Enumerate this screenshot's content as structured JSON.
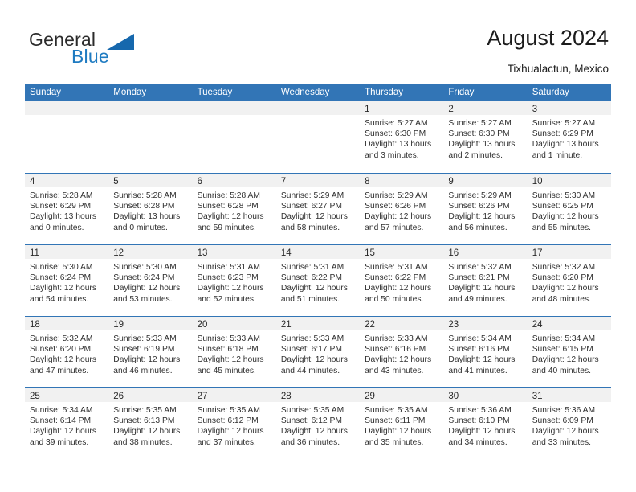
{
  "brand": {
    "word_one": "General",
    "word_two": "Blue",
    "triangle_icon": "triangle-logo-icon",
    "accent_color": "#1f7bc1"
  },
  "header": {
    "title": "August 2024",
    "location": "Tixhualactun, Mexico",
    "header_bg_color": "#3275b6",
    "daynum_band_color": "#f1f1f1"
  },
  "weekdays": [
    "Sunday",
    "Monday",
    "Tuesday",
    "Wednesday",
    "Thursday",
    "Friday",
    "Saturday"
  ],
  "labels": {
    "sunrise_prefix": "Sunrise:",
    "sunset_prefix": "Sunset:",
    "daylight_prefix": "Daylight:"
  },
  "weeks": [
    [
      {
        "day": "",
        "empty": true
      },
      {
        "day": "",
        "empty": true
      },
      {
        "day": "",
        "empty": true
      },
      {
        "day": "",
        "empty": true
      },
      {
        "day": "1",
        "sunrise": "Sunrise: 5:27 AM",
        "sunset": "Sunset: 6:30 PM",
        "daylight_1": "Daylight: 13 hours",
        "daylight_2": "and 3 minutes."
      },
      {
        "day": "2",
        "sunrise": "Sunrise: 5:27 AM",
        "sunset": "Sunset: 6:30 PM",
        "daylight_1": "Daylight: 13 hours",
        "daylight_2": "and 2 minutes."
      },
      {
        "day": "3",
        "sunrise": "Sunrise: 5:27 AM",
        "sunset": "Sunset: 6:29 PM",
        "daylight_1": "Daylight: 13 hours",
        "daylight_2": "and 1 minute."
      }
    ],
    [
      {
        "day": "4",
        "sunrise": "Sunrise: 5:28 AM",
        "sunset": "Sunset: 6:29 PM",
        "daylight_1": "Daylight: 13 hours",
        "daylight_2": "and 0 minutes."
      },
      {
        "day": "5",
        "sunrise": "Sunrise: 5:28 AM",
        "sunset": "Sunset: 6:28 PM",
        "daylight_1": "Daylight: 13 hours",
        "daylight_2": "and 0 minutes."
      },
      {
        "day": "6",
        "sunrise": "Sunrise: 5:28 AM",
        "sunset": "Sunset: 6:28 PM",
        "daylight_1": "Daylight: 12 hours",
        "daylight_2": "and 59 minutes."
      },
      {
        "day": "7",
        "sunrise": "Sunrise: 5:29 AM",
        "sunset": "Sunset: 6:27 PM",
        "daylight_1": "Daylight: 12 hours",
        "daylight_2": "and 58 minutes."
      },
      {
        "day": "8",
        "sunrise": "Sunrise: 5:29 AM",
        "sunset": "Sunset: 6:26 PM",
        "daylight_1": "Daylight: 12 hours",
        "daylight_2": "and 57 minutes."
      },
      {
        "day": "9",
        "sunrise": "Sunrise: 5:29 AM",
        "sunset": "Sunset: 6:26 PM",
        "daylight_1": "Daylight: 12 hours",
        "daylight_2": "and 56 minutes."
      },
      {
        "day": "10",
        "sunrise": "Sunrise: 5:30 AM",
        "sunset": "Sunset: 6:25 PM",
        "daylight_1": "Daylight: 12 hours",
        "daylight_2": "and 55 minutes."
      }
    ],
    [
      {
        "day": "11",
        "sunrise": "Sunrise: 5:30 AM",
        "sunset": "Sunset: 6:24 PM",
        "daylight_1": "Daylight: 12 hours",
        "daylight_2": "and 54 minutes."
      },
      {
        "day": "12",
        "sunrise": "Sunrise: 5:30 AM",
        "sunset": "Sunset: 6:24 PM",
        "daylight_1": "Daylight: 12 hours",
        "daylight_2": "and 53 minutes."
      },
      {
        "day": "13",
        "sunrise": "Sunrise: 5:31 AM",
        "sunset": "Sunset: 6:23 PM",
        "daylight_1": "Daylight: 12 hours",
        "daylight_2": "and 52 minutes."
      },
      {
        "day": "14",
        "sunrise": "Sunrise: 5:31 AM",
        "sunset": "Sunset: 6:22 PM",
        "daylight_1": "Daylight: 12 hours",
        "daylight_2": "and 51 minutes."
      },
      {
        "day": "15",
        "sunrise": "Sunrise: 5:31 AM",
        "sunset": "Sunset: 6:22 PM",
        "daylight_1": "Daylight: 12 hours",
        "daylight_2": "and 50 minutes."
      },
      {
        "day": "16",
        "sunrise": "Sunrise: 5:32 AM",
        "sunset": "Sunset: 6:21 PM",
        "daylight_1": "Daylight: 12 hours",
        "daylight_2": "and 49 minutes."
      },
      {
        "day": "17",
        "sunrise": "Sunrise: 5:32 AM",
        "sunset": "Sunset: 6:20 PM",
        "daylight_1": "Daylight: 12 hours",
        "daylight_2": "and 48 minutes."
      }
    ],
    [
      {
        "day": "18",
        "sunrise": "Sunrise: 5:32 AM",
        "sunset": "Sunset: 6:20 PM",
        "daylight_1": "Daylight: 12 hours",
        "daylight_2": "and 47 minutes."
      },
      {
        "day": "19",
        "sunrise": "Sunrise: 5:33 AM",
        "sunset": "Sunset: 6:19 PM",
        "daylight_1": "Daylight: 12 hours",
        "daylight_2": "and 46 minutes."
      },
      {
        "day": "20",
        "sunrise": "Sunrise: 5:33 AM",
        "sunset": "Sunset: 6:18 PM",
        "daylight_1": "Daylight: 12 hours",
        "daylight_2": "and 45 minutes."
      },
      {
        "day": "21",
        "sunrise": "Sunrise: 5:33 AM",
        "sunset": "Sunset: 6:17 PM",
        "daylight_1": "Daylight: 12 hours",
        "daylight_2": "and 44 minutes."
      },
      {
        "day": "22",
        "sunrise": "Sunrise: 5:33 AM",
        "sunset": "Sunset: 6:16 PM",
        "daylight_1": "Daylight: 12 hours",
        "daylight_2": "and 43 minutes."
      },
      {
        "day": "23",
        "sunrise": "Sunrise: 5:34 AM",
        "sunset": "Sunset: 6:16 PM",
        "daylight_1": "Daylight: 12 hours",
        "daylight_2": "and 41 minutes."
      },
      {
        "day": "24",
        "sunrise": "Sunrise: 5:34 AM",
        "sunset": "Sunset: 6:15 PM",
        "daylight_1": "Daylight: 12 hours",
        "daylight_2": "and 40 minutes."
      }
    ],
    [
      {
        "day": "25",
        "sunrise": "Sunrise: 5:34 AM",
        "sunset": "Sunset: 6:14 PM",
        "daylight_1": "Daylight: 12 hours",
        "daylight_2": "and 39 minutes."
      },
      {
        "day": "26",
        "sunrise": "Sunrise: 5:35 AM",
        "sunset": "Sunset: 6:13 PM",
        "daylight_1": "Daylight: 12 hours",
        "daylight_2": "and 38 minutes."
      },
      {
        "day": "27",
        "sunrise": "Sunrise: 5:35 AM",
        "sunset": "Sunset: 6:12 PM",
        "daylight_1": "Daylight: 12 hours",
        "daylight_2": "and 37 minutes."
      },
      {
        "day": "28",
        "sunrise": "Sunrise: 5:35 AM",
        "sunset": "Sunset: 6:12 PM",
        "daylight_1": "Daylight: 12 hours",
        "daylight_2": "and 36 minutes."
      },
      {
        "day": "29",
        "sunrise": "Sunrise: 5:35 AM",
        "sunset": "Sunset: 6:11 PM",
        "daylight_1": "Daylight: 12 hours",
        "daylight_2": "and 35 minutes."
      },
      {
        "day": "30",
        "sunrise": "Sunrise: 5:36 AM",
        "sunset": "Sunset: 6:10 PM",
        "daylight_1": "Daylight: 12 hours",
        "daylight_2": "and 34 minutes."
      },
      {
        "day": "31",
        "sunrise": "Sunrise: 5:36 AM",
        "sunset": "Sunset: 6:09 PM",
        "daylight_1": "Daylight: 12 hours",
        "daylight_2": "and 33 minutes."
      }
    ]
  ]
}
